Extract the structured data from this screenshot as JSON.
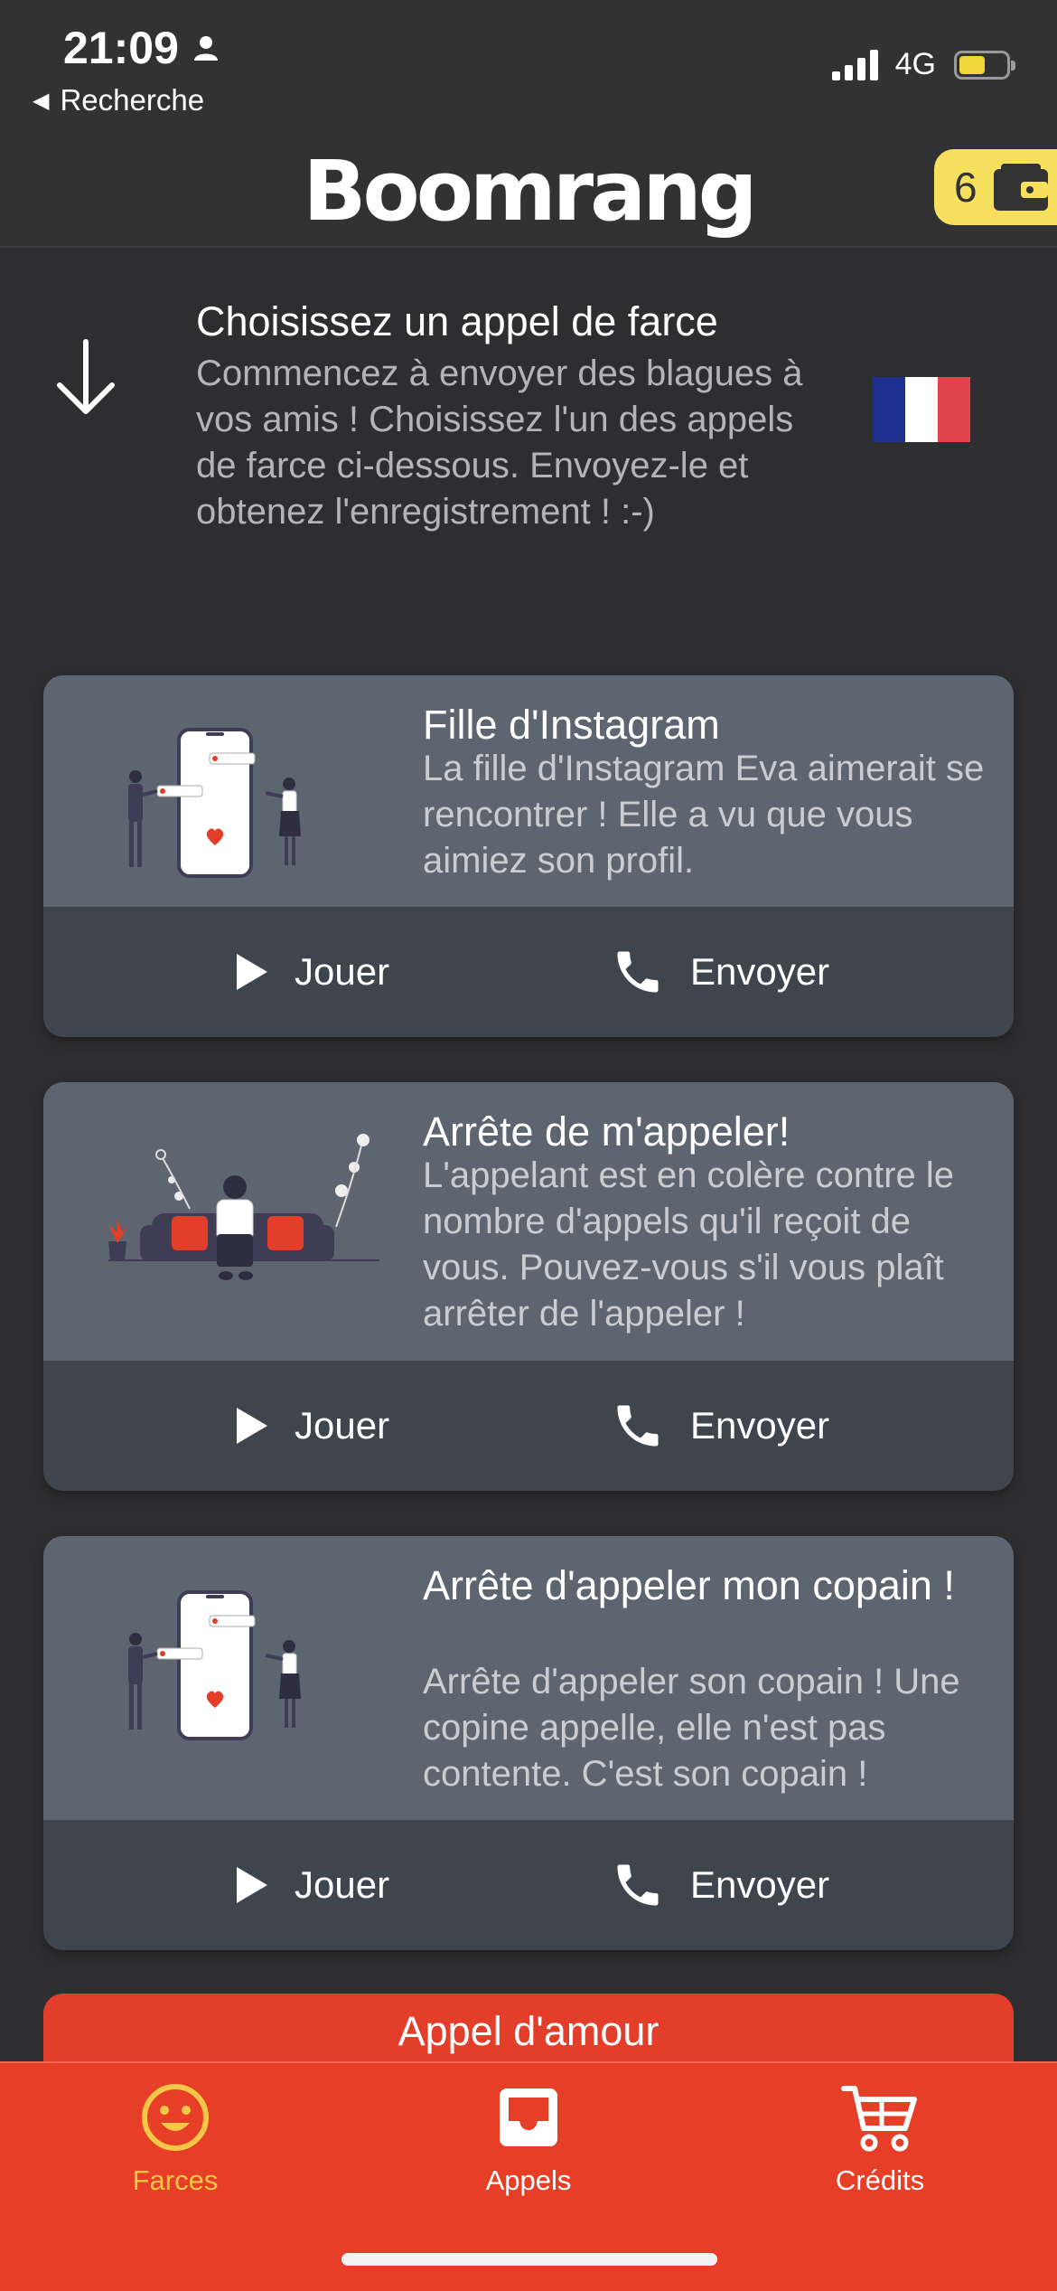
{
  "status_bar": {
    "time": "21:09",
    "back_label": "Recherche",
    "network": "4G",
    "battery_level": 0.55
  },
  "header": {
    "logo": "Boomrang",
    "credits_count": "6",
    "accent_color": "#f6e05e"
  },
  "intro": {
    "title": "Choisissez un appel de farce",
    "text": "Commencez à envoyer des blagues à vos amis ! Choisissez l'un des appels de farce ci-dessous. Envoyez-le et obtenez l'enregistrement ! :-)",
    "flag_colors": [
      "#1f2f8e",
      "#ffffff",
      "#e0444b"
    ]
  },
  "cards": [
    {
      "title": "Fille d'Instagram",
      "description": "La fille d'Instagram Eva aimerait se rencontrer ! Elle a vu que vous aimiez son profil.",
      "play_label": "Jouer",
      "send_label": "Envoyer"
    },
    {
      "title": "Arrête de m'appeler!",
      "description": "L'appelant est en colère contre le nombre d'appels qu'il reçoit de vous. Pouvez-vous s'il vous plaît arrêter de l'appeler !",
      "play_label": "Jouer",
      "send_label": "Envoyer"
    },
    {
      "title": "Arrête d'appeler mon copain !",
      "description": "Arrête d'appeler son copain ! Une copine appelle, elle n'est pas contente. C'est son copain !",
      "play_label": "Jouer",
      "send_label": "Envoyer"
    }
  ],
  "next_card_title": "Appel d'amour",
  "tab_bar": {
    "background": "#e63e27",
    "active_color": "#f6c646",
    "tabs": [
      {
        "label": "Farces",
        "icon": "smiley-icon",
        "active": true
      },
      {
        "label": "Appels",
        "icon": "inbox-icon",
        "active": false
      },
      {
        "label": "Crédits",
        "icon": "cart-icon",
        "active": false
      }
    ]
  }
}
